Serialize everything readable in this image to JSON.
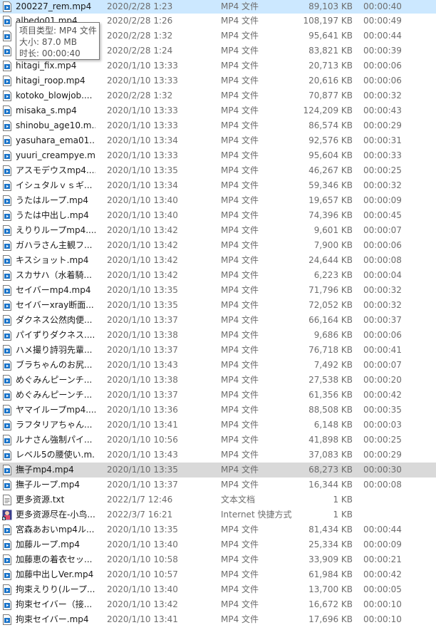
{
  "tooltip": {
    "type_line": "项目类型: MP4 文件",
    "size_line": "大小: 87.0 MB",
    "duration_line": "时长: 00:00:40"
  },
  "colors": {
    "selected_row": "#cce8ff",
    "hover_row": "#d9d9d9",
    "video_icon_blue": "#1a73c8"
  },
  "files": [
    {
      "name": "200227_rem.mp4",
      "date": "2020/2/28 1:23",
      "type": "MP4 文件",
      "size": "89,103 KB",
      "duration": "00:00:40",
      "icon": "video-file-icon"
    },
    {
      "name": "albedo01.mp4",
      "date": "2020/2/28 1:26",
      "type": "MP4 文件",
      "size": "108,197 KB",
      "duration": "00:00:49",
      "icon": "video-file-icon"
    },
    {
      "name": "",
      "date": "2020/2/28 1:32",
      "type": "MP4 文件",
      "size": "95,641 KB",
      "duration": "00:00:44",
      "icon": "video-file-icon"
    },
    {
      "name": "",
      "date": "2020/2/28 1:24",
      "type": "MP4 文件",
      "size": "83,821 KB",
      "duration": "00:00:39",
      "icon": "video-file-icon"
    },
    {
      "name": "hitagi_fix.mp4",
      "date": "2020/1/10 13:33",
      "type": "MP4 文件",
      "size": "20,713 KB",
      "duration": "00:00:06",
      "icon": "video-file-icon"
    },
    {
      "name": "hitagi_roop.mp4",
      "date": "2020/1/10 13:33",
      "type": "MP4 文件",
      "size": "20,616 KB",
      "duration": "00:00:06",
      "icon": "video-file-icon"
    },
    {
      "name": "kotoko_blowjob....",
      "date": "2020/2/28 1:32",
      "type": "MP4 文件",
      "size": "70,877 KB",
      "duration": "00:00:32",
      "icon": "video-file-icon"
    },
    {
      "name": "misaka_s.mp4",
      "date": "2020/1/10 13:33",
      "type": "MP4 文件",
      "size": "124,209 KB",
      "duration": "00:00:43",
      "icon": "video-file-icon"
    },
    {
      "name": "shinobu_age10.m...",
      "date": "2020/1/10 13:33",
      "type": "MP4 文件",
      "size": "86,574 KB",
      "duration": "00:00:29",
      "icon": "video-file-icon"
    },
    {
      "name": "yasuhara_ema01....",
      "date": "2020/1/10 13:34",
      "type": "MP4 文件",
      "size": "92,576 KB",
      "duration": "00:00:31",
      "icon": "video-file-icon"
    },
    {
      "name": "yuuri_creampye.m...",
      "date": "2020/1/10 13:33",
      "type": "MP4 文件",
      "size": "95,604 KB",
      "duration": "00:00:33",
      "icon": "video-file-icon"
    },
    {
      "name": "アスモデウスmp4....",
      "date": "2020/1/10 13:35",
      "type": "MP4 文件",
      "size": "46,267 KB",
      "duration": "00:00:25",
      "icon": "video-file-icon"
    },
    {
      "name": "イシュタルｖｓギ...",
      "date": "2020/1/10 13:34",
      "type": "MP4 文件",
      "size": "59,346 KB",
      "duration": "00:00:32",
      "icon": "video-file-icon"
    },
    {
      "name": "うたはループ.mp4",
      "date": "2020/1/10 13:40",
      "type": "MP4 文件",
      "size": "19,657 KB",
      "duration": "00:00:09",
      "icon": "video-file-icon"
    },
    {
      "name": "うたは中出し.mp4",
      "date": "2020/1/10 13:40",
      "type": "MP4 文件",
      "size": "74,396 KB",
      "duration": "00:00:45",
      "icon": "video-file-icon"
    },
    {
      "name": "えりりループmp4....",
      "date": "2020/1/10 13:42",
      "type": "MP4 文件",
      "size": "9,601 KB",
      "duration": "00:00:07",
      "icon": "video-file-icon"
    },
    {
      "name": "ガハラさん主観フ...",
      "date": "2020/1/10 13:42",
      "type": "MP4 文件",
      "size": "7,900 KB",
      "duration": "00:00:06",
      "icon": "video-file-icon"
    },
    {
      "name": "キスショット.mp4",
      "date": "2020/1/10 13:42",
      "type": "MP4 文件",
      "size": "24,644 KB",
      "duration": "00:00:08",
      "icon": "video-file-icon"
    },
    {
      "name": "スカサハ（水着騎...",
      "date": "2020/1/10 13:42",
      "type": "MP4 文件",
      "size": "6,223 KB",
      "duration": "00:00:04",
      "icon": "video-file-icon"
    },
    {
      "name": "セイバーmp4.mp4",
      "date": "2020/1/10 13:35",
      "type": "MP4 文件",
      "size": "71,796 KB",
      "duration": "00:00:32",
      "icon": "video-file-icon"
    },
    {
      "name": "セイバーxray断面...",
      "date": "2020/1/10 13:35",
      "type": "MP4 文件",
      "size": "72,052 KB",
      "duration": "00:00:32",
      "icon": "video-file-icon"
    },
    {
      "name": "ダクネス公然肉便...",
      "date": "2020/1/10 13:37",
      "type": "MP4 文件",
      "size": "66,164 KB",
      "duration": "00:00:37",
      "icon": "video-file-icon"
    },
    {
      "name": "パイずりダクネス....",
      "date": "2020/1/10 13:38",
      "type": "MP4 文件",
      "size": "9,686 KB",
      "duration": "00:00:06",
      "icon": "video-file-icon"
    },
    {
      "name": "ハメ撮り詩羽先輩...",
      "date": "2020/1/10 13:37",
      "type": "MP4 文件",
      "size": "76,718 KB",
      "duration": "00:00:41",
      "icon": "video-file-icon"
    },
    {
      "name": "ブラちゃんのお尻...",
      "date": "2020/1/10 13:43",
      "type": "MP4 文件",
      "size": "7,492 KB",
      "duration": "00:00:07",
      "icon": "video-file-icon"
    },
    {
      "name": "めぐみんピーンチ...",
      "date": "2020/1/10 13:38",
      "type": "MP4 文件",
      "size": "27,538 KB",
      "duration": "00:00:20",
      "icon": "video-file-icon"
    },
    {
      "name": "めぐみんピーンチ...",
      "date": "2020/1/10 13:37",
      "type": "MP4 文件",
      "size": "61,356 KB",
      "duration": "00:00:42",
      "icon": "video-file-icon"
    },
    {
      "name": "ヤマイループmp4....",
      "date": "2020/1/10 13:36",
      "type": "MP4 文件",
      "size": "88,508 KB",
      "duration": "00:00:35",
      "icon": "video-file-icon"
    },
    {
      "name": "ラフタリアちゃん...",
      "date": "2020/1/10 13:41",
      "type": "MP4 文件",
      "size": "6,148 KB",
      "duration": "00:00:03",
      "icon": "video-file-icon"
    },
    {
      "name": "ルナさん強制パイ...",
      "date": "2020/1/10 10:56",
      "type": "MP4 文件",
      "size": "41,898 KB",
      "duration": "00:00:25",
      "icon": "video-file-icon"
    },
    {
      "name": "レベル5の腰使い.m...",
      "date": "2020/1/10 13:43",
      "type": "MP4 文件",
      "size": "37,083 KB",
      "duration": "00:00:29",
      "icon": "video-file-icon"
    },
    {
      "name": "撫子mp4.mp4",
      "date": "2020/1/10 13:35",
      "type": "MP4 文件",
      "size": "68,273 KB",
      "duration": "00:00:30",
      "icon": "video-file-icon",
      "hover": true
    },
    {
      "name": "撫子ループ.mp4",
      "date": "2020/1/10 13:37",
      "type": "MP4 文件",
      "size": "16,344 KB",
      "duration": "00:00:08",
      "icon": "video-file-icon"
    },
    {
      "name": "更多资源.txt",
      "date": "2022/1/7 12:46",
      "type": "文本文档",
      "size": "1 KB",
      "duration": "",
      "icon": "text-file-icon"
    },
    {
      "name": "更多资源尽在-小鸟...",
      "date": "2022/3/7 16:21",
      "type": "Internet 快捷方式",
      "size": "1 KB",
      "duration": "",
      "icon": "internet-shortcut-icon"
    },
    {
      "name": "宮森あおいmp4ル...",
      "date": "2020/1/10 13:35",
      "type": "MP4 文件",
      "size": "81,434 KB",
      "duration": "00:00:44",
      "icon": "video-file-icon"
    },
    {
      "name": "加藤ループ.mp4",
      "date": "2020/1/10 13:40",
      "type": "MP4 文件",
      "size": "25,334 KB",
      "duration": "00:00:09",
      "icon": "video-file-icon"
    },
    {
      "name": "加藤恵の着衣セッ...",
      "date": "2020/1/10 10:58",
      "type": "MP4 文件",
      "size": "33,909 KB",
      "duration": "00:00:21",
      "icon": "video-file-icon"
    },
    {
      "name": "加藤中出しVer.mp4",
      "date": "2020/1/10 10:57",
      "type": "MP4 文件",
      "size": "61,984 KB",
      "duration": "00:00:42",
      "icon": "video-file-icon"
    },
    {
      "name": "拘束えりり(ループ...",
      "date": "2020/1/10 13:40",
      "type": "MP4 文件",
      "size": "13,700 KB",
      "duration": "00:00:05",
      "icon": "video-file-icon"
    },
    {
      "name": "拘束セイバー（接...",
      "date": "2020/1/10 13:42",
      "type": "MP4 文件",
      "size": "16,672 KB",
      "duration": "00:00:10",
      "icon": "video-file-icon"
    },
    {
      "name": "拘束セイバー.mp4",
      "date": "2020/1/10 13:41",
      "type": "MP4 文件",
      "size": "17,696 KB",
      "duration": "00:00:10",
      "icon": "video-file-icon"
    }
  ]
}
